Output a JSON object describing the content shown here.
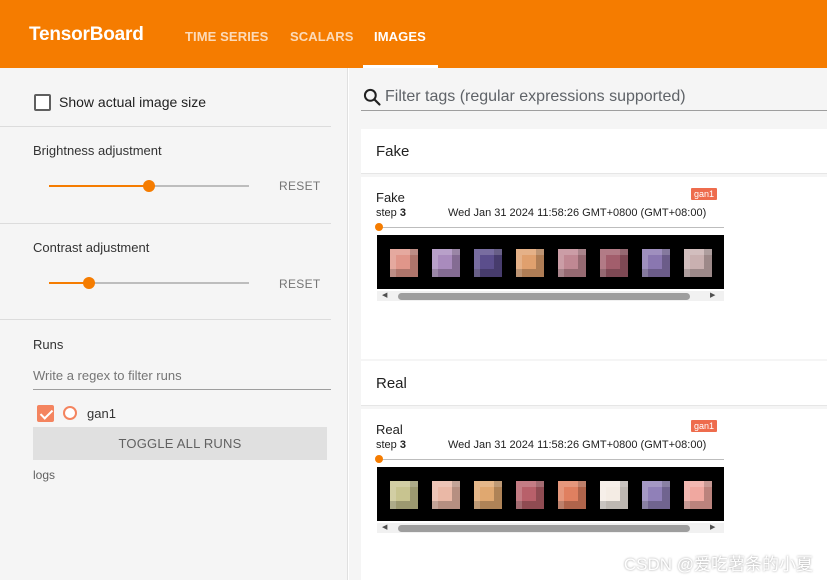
{
  "header": {
    "brand": "TensorBoard",
    "tabs": [
      {
        "label": "TIME SERIES"
      },
      {
        "label": "SCALARS"
      },
      {
        "label": "IMAGES"
      }
    ],
    "active_tab": "IMAGES",
    "accent_color": "#f57c00"
  },
  "sidebar": {
    "show_actual_size": {
      "label": "Show actual image size",
      "checked": false
    },
    "brightness": {
      "label": "Brightness adjustment",
      "value": 0.5,
      "reset_label": "RESET"
    },
    "contrast": {
      "label": "Contrast adjustment",
      "value": 0.2,
      "reset_label": "RESET"
    },
    "runs": {
      "title": "Runs",
      "filter_placeholder": "Write a regex to filter runs",
      "items": [
        {
          "name": "gan1",
          "checked": true,
          "color": "#f4845f"
        }
      ],
      "toggle_label": "TOGGLE ALL RUNS",
      "logdir": "logs"
    }
  },
  "main": {
    "search_placeholder": "Filter tags (regular expressions supported)",
    "groups": [
      {
        "title": "Fake",
        "card": {
          "tag": "Fake",
          "run": "gan1",
          "step_label": "step",
          "step": "3",
          "timestamp": "Wed Jan 31 2024 11:58:26 GMT+0800 (GMT+08:00)",
          "thumb_colors": [
            "#e0968a",
            "#a98bbd",
            "#5b4e8c",
            "#e0a06e",
            "#c08893",
            "#a25e6c",
            "#8a77b0",
            "#c9b0b0"
          ]
        }
      },
      {
        "title": "Real",
        "card": {
          "tag": "Real",
          "run": "gan1",
          "step_label": "step",
          "step": "3",
          "timestamp": "Wed Jan 31 2024 11:58:26 GMT+0800 (GMT+08:00)",
          "thumb_colors": [
            "#c8c490",
            "#eab8a6",
            "#e0a870",
            "#b8606a",
            "#e08060",
            "#f4ece4",
            "#9080b8",
            "#f0a8a0"
          ]
        }
      }
    ]
  },
  "watermark": "CSDN @爱吃薯条的小夏"
}
